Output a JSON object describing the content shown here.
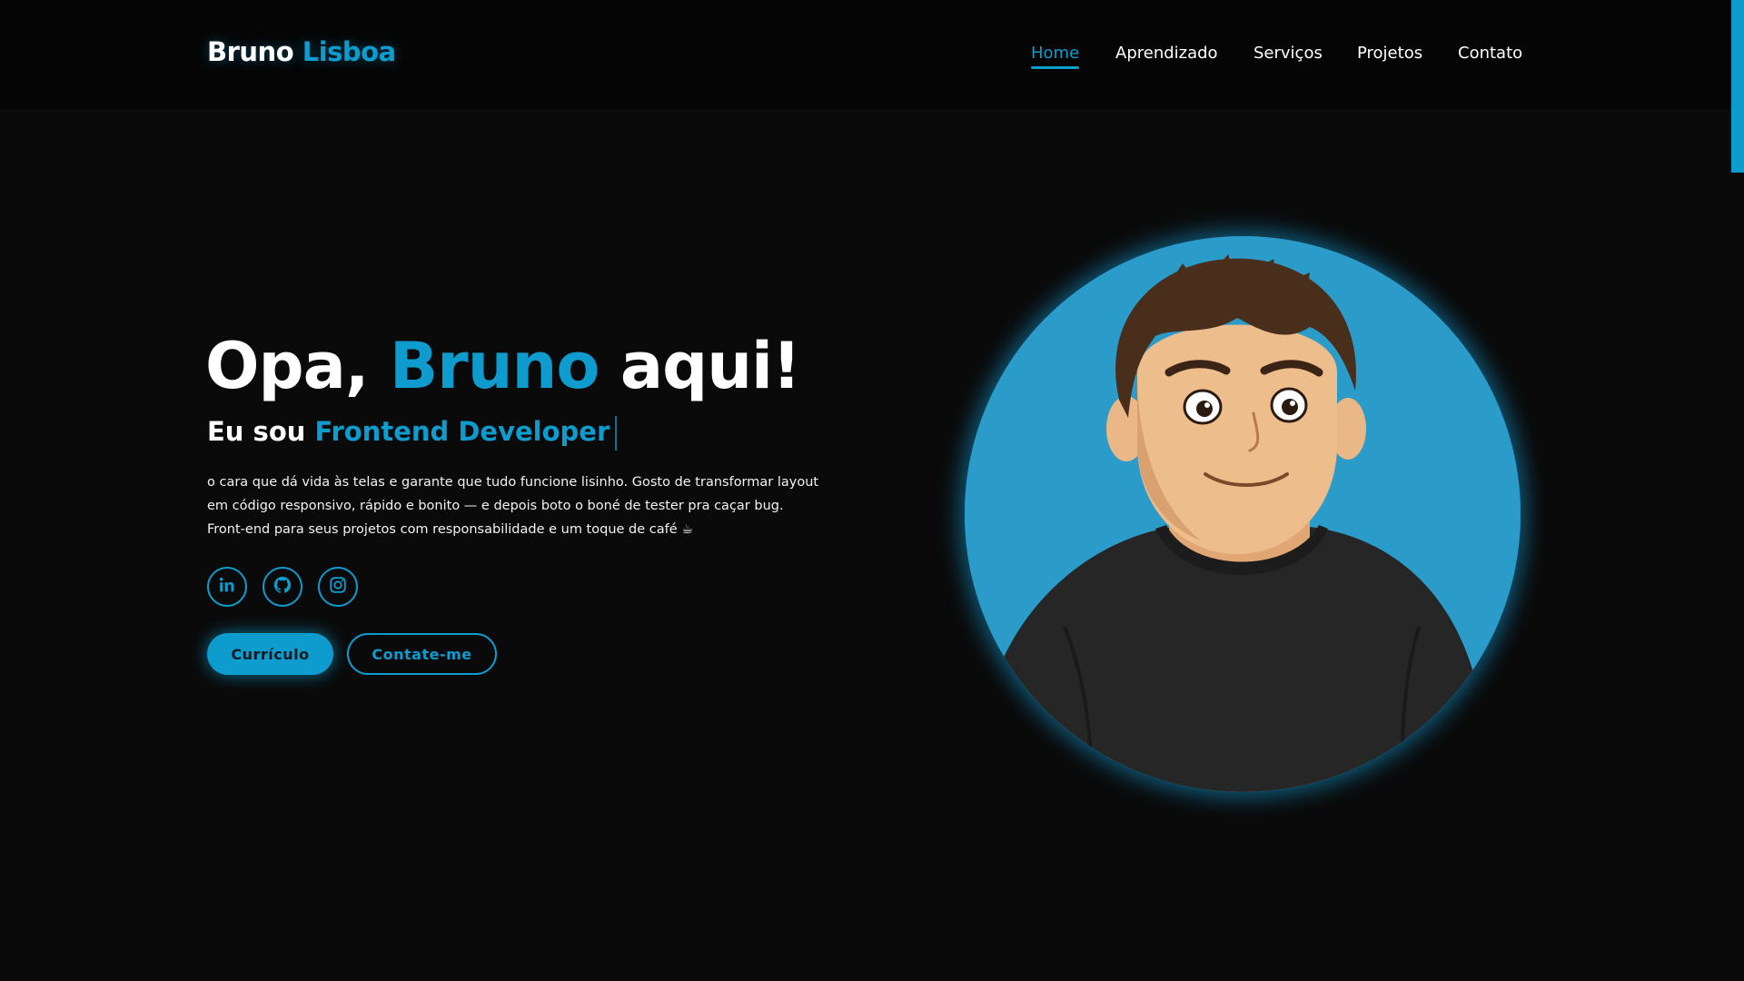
{
  "brand": {
    "first_name": "Bruno",
    "last_name": "Lisboa"
  },
  "nav": {
    "items": [
      {
        "label": "Home",
        "active": true
      },
      {
        "label": "Aprendizado",
        "active": false
      },
      {
        "label": "Serviços",
        "active": false
      },
      {
        "label": "Projetos",
        "active": false
      },
      {
        "label": "Contato",
        "active": false
      }
    ]
  },
  "hero": {
    "title_prefix": "Opa,",
    "title_name": "Bruno",
    "title_suffix": "aqui!",
    "subtitle_prefix": "Eu sou",
    "subtitle_role": "Frontend Developer",
    "description_line1": "o cara que dá vida às telas e garante que tudo funcione lisinho. Gosto de transformar layout",
    "description_line2": "em código responsivo, rápido e bonito — e depois boto o boné de tester pra caçar bug.",
    "description_line3": "Front-end para seus projetos com responsabilidade e um toque de café ☕"
  },
  "socials": [
    {
      "icon": "linkedin-icon"
    },
    {
      "icon": "github-icon"
    },
    {
      "icon": "instagram-icon"
    }
  ],
  "buttons": {
    "primary_label": "Currículo",
    "secondary_label": "Contate-me"
  },
  "colors": {
    "accent": "#0d9ccd",
    "background": "#0a0a0a",
    "avatar_bg": "#2b9bc9"
  }
}
